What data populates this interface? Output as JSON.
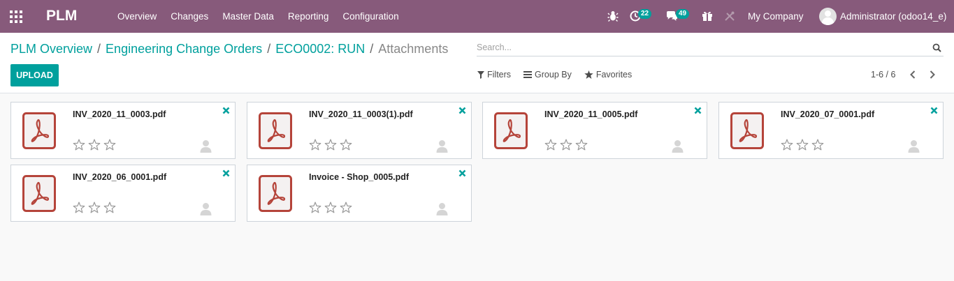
{
  "app": {
    "brand": "PLM"
  },
  "nav": {
    "menu": [
      "Overview",
      "Changes",
      "Master Data",
      "Reporting",
      "Configuration"
    ],
    "activity_count": "22",
    "message_count": "49",
    "company": "My Company",
    "user": "Administrator (odoo14_e)"
  },
  "breadcrumb": {
    "items": [
      "PLM Overview",
      "Engineering Change Orders",
      "ECO0002: RUN"
    ],
    "current": "Attachments"
  },
  "buttons": {
    "upload": "UPLOAD"
  },
  "search": {
    "placeholder": "Search..."
  },
  "filters": {
    "filters": "Filters",
    "group_by": "Group By",
    "favorites": "Favorites"
  },
  "pager": {
    "value": "1-6 / 6"
  },
  "attachments": [
    {
      "name": "INV_2020_11_0003.pdf",
      "stars": 0
    },
    {
      "name": "INV_2020_11_0003(1).pdf",
      "stars": 0
    },
    {
      "name": "INV_2020_11_0005.pdf",
      "stars": 0
    },
    {
      "name": "INV_2020_07_0001.pdf",
      "stars": 0
    },
    {
      "name": "INV_2020_06_0001.pdf",
      "stars": 0
    },
    {
      "name": "Invoice - Shop_0005.pdf",
      "stars": 0
    }
  ],
  "colors": {
    "navbar": "#875a7b",
    "accent": "#00a09d",
    "pdf_icon": "#b5443a",
    "delete_icon": "#00a09d"
  },
  "icons": {
    "apps": "grid-icon",
    "bug": "bug-icon",
    "activity": "clock-icon",
    "messages": "chat-icon",
    "gift": "gift-icon",
    "tools": "tools-icon",
    "search": "search-icon",
    "filter": "filter-icon",
    "group_by": "list-icon",
    "favorites": "star-icon",
    "file": "pdf-file-icon",
    "rating": "star-outline-icon",
    "delete": "close-icon",
    "owner": "user-icon"
  }
}
